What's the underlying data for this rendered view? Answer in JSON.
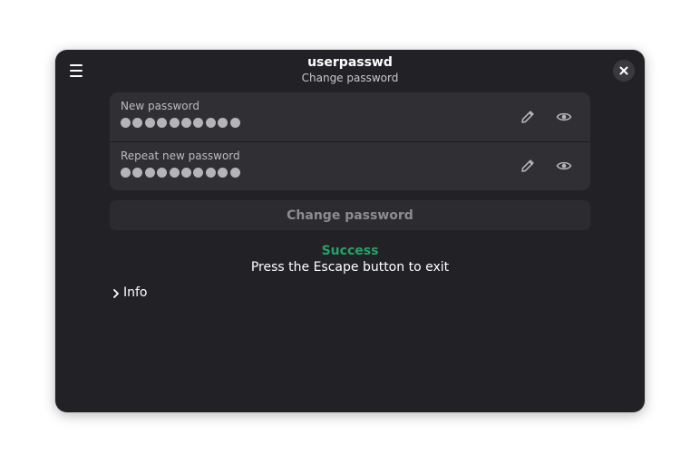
{
  "window": {
    "title": "userpasswd",
    "subtitle": "Change password"
  },
  "header": {
    "menu_icon": "hamburger-menu-icon",
    "close_icon": "close-icon"
  },
  "fields": [
    {
      "label": "New password",
      "masked_length": 10,
      "edit_icon": "pencil-icon",
      "reveal_icon": "eye-icon"
    },
    {
      "label": "Repeat new password",
      "masked_length": 10,
      "edit_icon": "pencil-icon",
      "reveal_icon": "eye-icon"
    }
  ],
  "change_button": {
    "label": "Change password",
    "enabled": false
  },
  "status": {
    "title": "Success",
    "message": "Press the Escape button to exit"
  },
  "info": {
    "label": "Info",
    "expanded": false,
    "icon": "chevron-right-icon"
  },
  "colors": {
    "window_bg": "#222226",
    "card_bg": "#2f2f34",
    "success": "#26a269",
    "text": "#ffffff",
    "muted_text": "#bcbcc0"
  }
}
